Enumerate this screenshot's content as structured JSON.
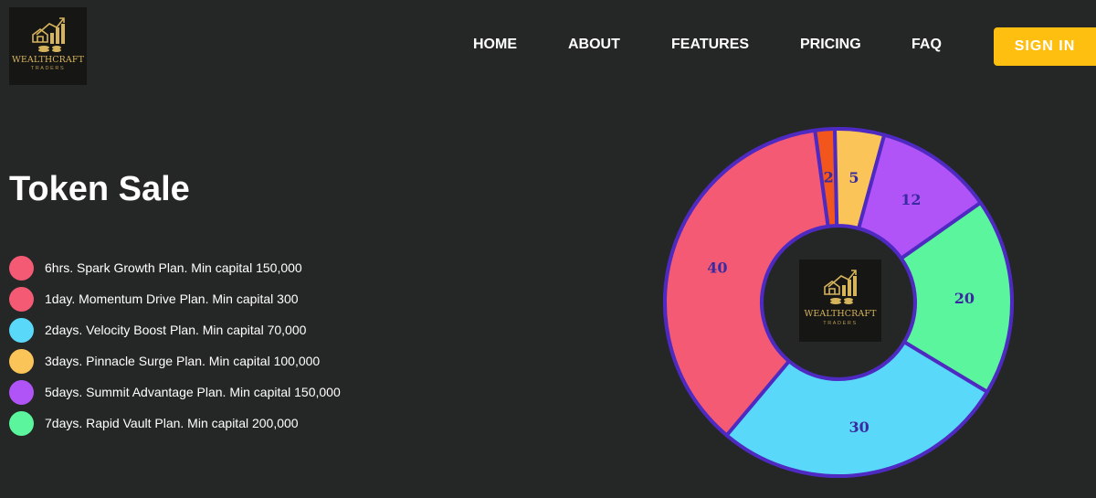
{
  "header": {
    "logo": {
      "name": "WEALTHCRAFT",
      "sub": "TRADERS",
      "gold": "#d6b45c"
    },
    "nav": [
      {
        "label": "HOME"
      },
      {
        "label": "ABOUT"
      },
      {
        "label": "FEATURES"
      },
      {
        "label": "PRICING"
      },
      {
        "label": "FAQ"
      }
    ],
    "signin_label": "SIGN IN",
    "signin_color": "#ffbf10"
  },
  "main": {
    "title": "Token Sale",
    "legend": [
      {
        "label": "6hrs. Spark Growth Plan. Min capital 150,000",
        "color": "#f55a75"
      },
      {
        "label": "1day. Momentum Drive Plan. Min capital 300",
        "color": "#f55a75"
      },
      {
        "label": "2days. Velocity Boost Plan. Min capital 70,000",
        "color": "#5ad8fa"
      },
      {
        "label": "3days. Pinnacle Surge Plan. Min capital 100,000",
        "color": "#fbc458"
      },
      {
        "label": "5days. Summit Advantage Plan. Min capital 150,000",
        "color": "#b154f7"
      },
      {
        "label": "7days. Rapid Vault Plan. Min capital 200,000",
        "color": "#5af59c"
      }
    ]
  },
  "chart_data": {
    "type": "pie",
    "donut": true,
    "values": [
      2,
      5,
      12,
      20,
      30,
      40
    ],
    "labels": [
      "2",
      "5",
      "12",
      "20",
      "30",
      "40"
    ],
    "colors": [
      "#f2561d",
      "#fbc458",
      "#b154f7",
      "#5af59c",
      "#5ad8fa",
      "#f55a75"
    ],
    "border_color": "#4e2ac2",
    "label_color": "#3a2aa0"
  }
}
